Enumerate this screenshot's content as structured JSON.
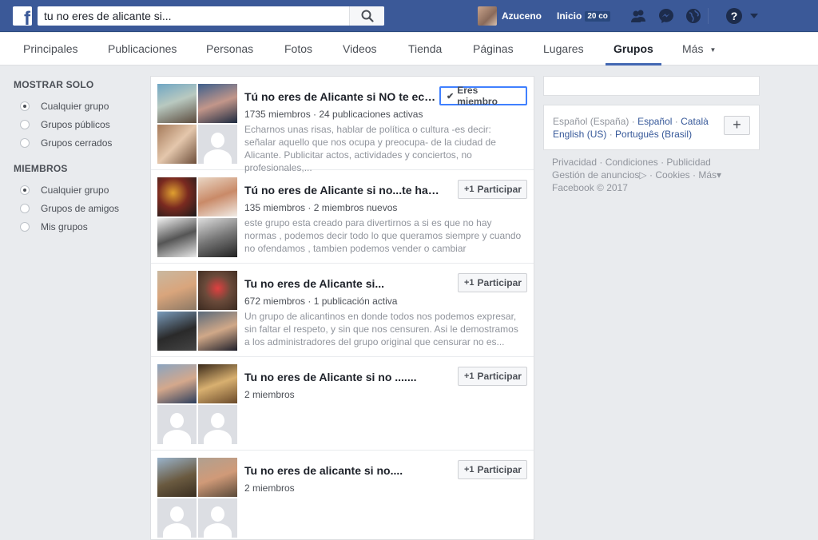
{
  "search": {
    "query": "tu no eres de alicante si..."
  },
  "user": {
    "name": "Azuceno"
  },
  "home": {
    "label": "Inicio",
    "badge": "20 co"
  },
  "tabs": [
    {
      "label": "Principales"
    },
    {
      "label": "Publicaciones"
    },
    {
      "label": "Personas"
    },
    {
      "label": "Fotos"
    },
    {
      "label": "Videos"
    },
    {
      "label": "Tienda"
    },
    {
      "label": "Páginas"
    },
    {
      "label": "Lugares"
    },
    {
      "label": "Grupos"
    },
    {
      "label": "Más"
    }
  ],
  "filters": {
    "show_only": {
      "title": "MOSTRAR SOLO",
      "options": [
        "Cualquier grupo",
        "Grupos públicos",
        "Grupos cerrados"
      ]
    },
    "members": {
      "title": "MIEMBROS",
      "options": [
        "Cualquier grupo",
        "Grupos de amigos",
        "Mis grupos"
      ]
    }
  },
  "groups": [
    {
      "title": "Tú no eres de Alicante si NO te echan de menos",
      "meta": "1735 miembros · 24 publicaciones activas",
      "description": "Echarnos unas risas, hablar de política o cultura -es decir: señalar aquello que nos ocupa y preocupa- de la ciudad de Alicante. Publicitar actos, actividades y conciertos, no profesionales,...",
      "button": "Eres miembro"
    },
    {
      "title": "Tú no eres de Alicante si no...te han echado",
      "meta": "135 miembros · 2 miembros nuevos",
      "description": "este grupo esta creado para divertirnos a si es que no hay normas , podemos decir todo lo que queramos siempre y cuando no ofendamos , tambien podemos vender o cambiar",
      "button": "Participar"
    },
    {
      "title": "Tu no eres de Alicante si...",
      "meta": "672 miembros · 1 publicación activa",
      "description": "Un grupo de alicantinos en donde todos nos podemos expresar, sin faltar el respeto, y sin que nos censuren. Asi le demostramos a los administradores del grupo original que censurar no es...",
      "button": "Participar"
    },
    {
      "title": "Tu no eres de Alicante si no .......",
      "meta": "2 miembros",
      "description": "",
      "button": "Participar"
    },
    {
      "title": "Tu no eres de alicante si no....",
      "meta": "2 miembros",
      "description": "",
      "button": "Participar"
    }
  ],
  "languages": {
    "current": "Español (España)",
    "others": [
      "Español",
      "Català",
      "English (US)",
      "Português (Brasil)"
    ]
  },
  "footer": {
    "links": [
      "Privacidad",
      "Condiciones",
      "Publicidad",
      "Gestión de anuncios",
      "Cookies",
      "Más"
    ],
    "copyright": "Facebook © 2017"
  },
  "colors": {
    "brand": "#3b5998",
    "link": "#365899",
    "accent": "#4267b2"
  }
}
